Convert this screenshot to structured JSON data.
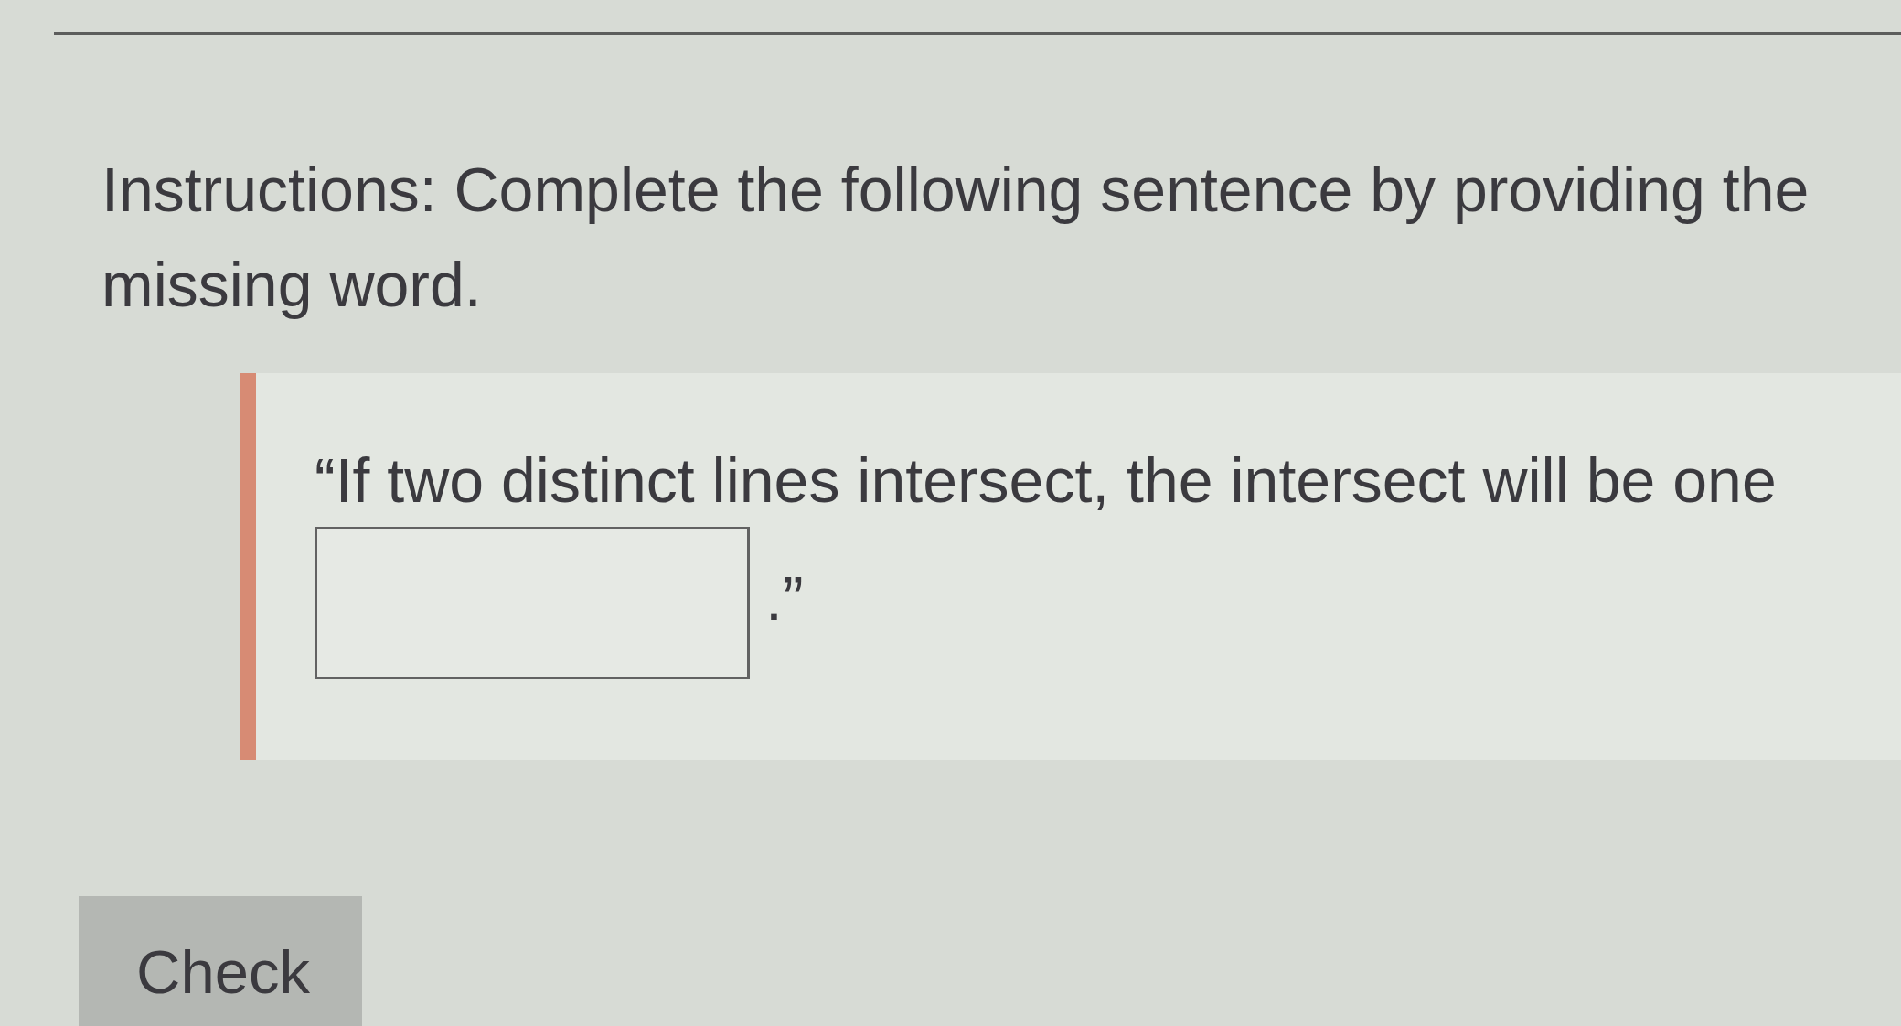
{
  "instructions": "Instructions: Complete the following sentence by providing the missing word.",
  "sentence": [
    {
      "kind": "text",
      "text": "“If two distinct lines intersect, the intersect will be one"
    },
    {
      "kind": "blank"
    },
    {
      "kind": "text",
      "text": ".”"
    }
  ],
  "check_button": {
    "label": "Check"
  }
}
